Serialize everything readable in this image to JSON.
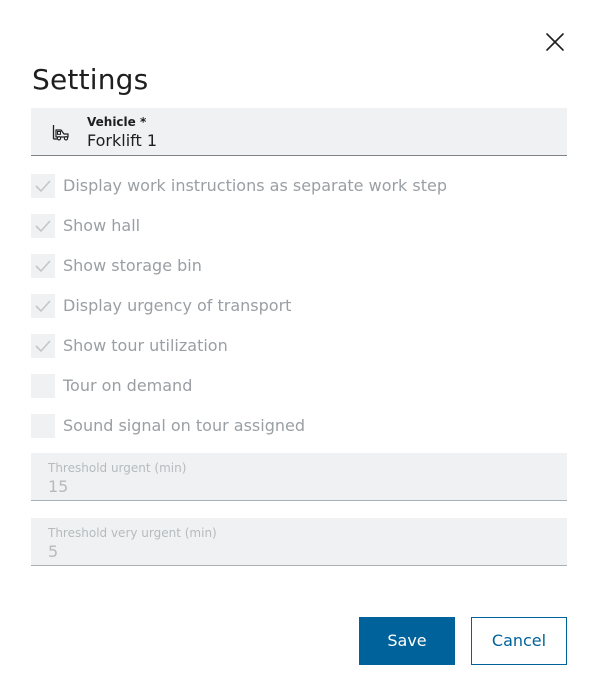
{
  "dialog": {
    "title": "Settings"
  },
  "vehicle": {
    "label": "Vehicle *",
    "value": "Forklift 1",
    "icon": "forklift-icon"
  },
  "options": [
    {
      "label": "Display work instructions as separate work step",
      "checked": true
    },
    {
      "label": "Show hall",
      "checked": true
    },
    {
      "label": "Show storage bin",
      "checked": true
    },
    {
      "label": "Display urgency of transport",
      "checked": true
    },
    {
      "label": "Show tour utilization",
      "checked": true
    },
    {
      "label": "Tour on demand",
      "checked": false
    },
    {
      "label": "Sound signal on tour assigned",
      "checked": false
    }
  ],
  "thresholds": [
    {
      "label": "Threshold urgent (min)",
      "value": "15"
    },
    {
      "label": "Threshold very urgent (min)",
      "value": "5"
    }
  ],
  "actions": {
    "save_label": "Save",
    "cancel_label": "Cancel"
  },
  "colors": {
    "primary": "#00629a",
    "field_background": "#eff1f2",
    "disabled_text": "#9a9fa4"
  }
}
